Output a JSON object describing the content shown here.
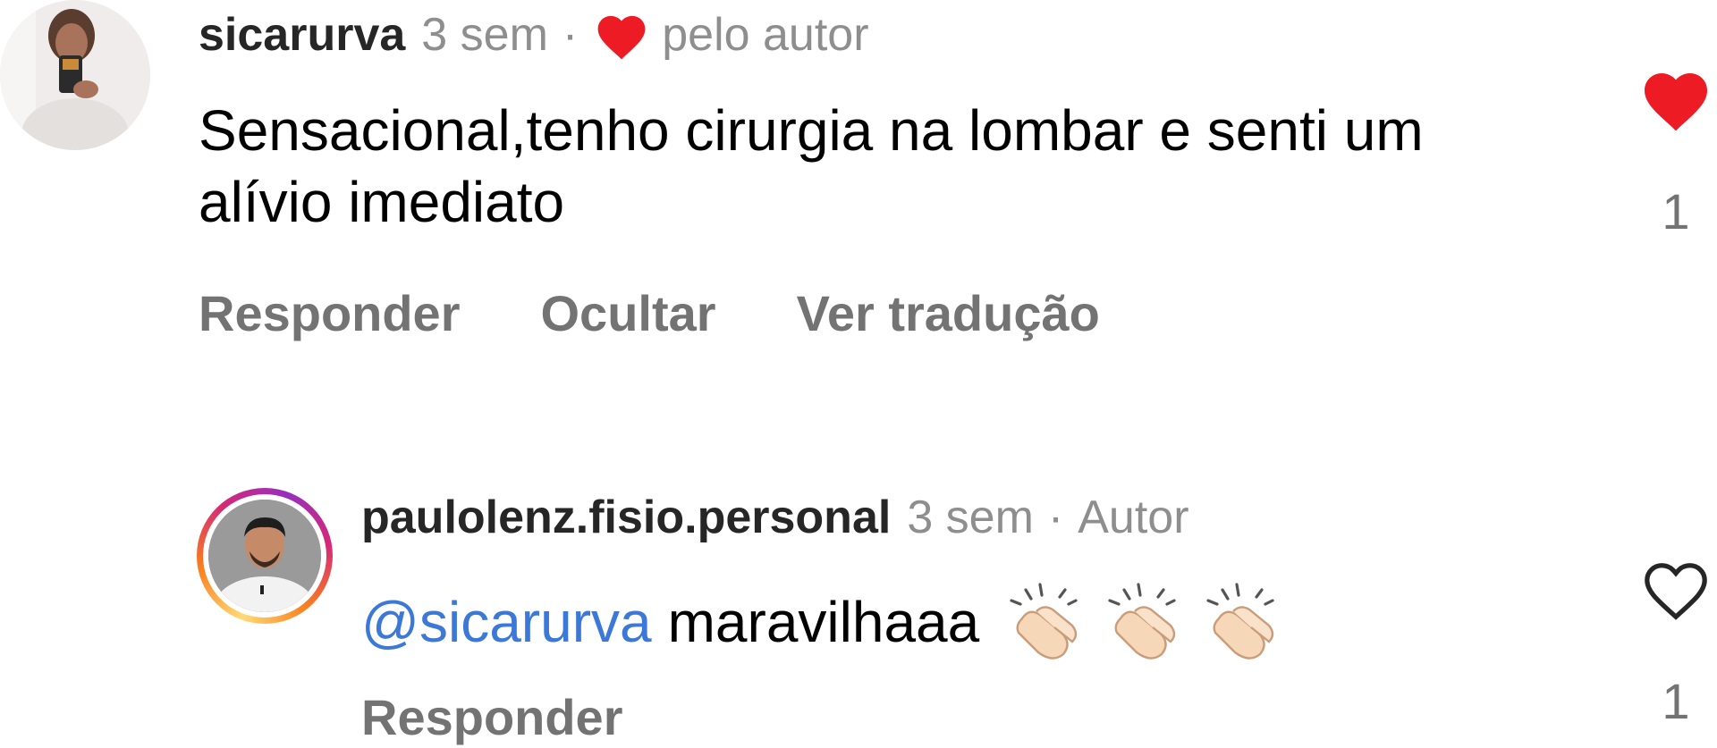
{
  "comments": [
    {
      "username": "sicarurva",
      "time": "3 sem",
      "separator": "·",
      "liked_by_author_label": "pelo autor",
      "text": "Sensacional,tenho cirurgia na lombar e senti um alívio imediato",
      "actions": [
        "Responder",
        "Ocultar",
        "Ver tradução"
      ],
      "likes": "1",
      "liked": true
    },
    {
      "username": "paulolenz.fisio.personal",
      "time": "3 sem",
      "separator": "·",
      "author_badge": "Autor",
      "mention": "@sicarurva",
      "text": "maravilhaaa",
      "emoji": [
        "clapping-hands-icon",
        "clapping-hands-icon",
        "clapping-hands-icon"
      ],
      "actions": [
        "Responder"
      ],
      "likes": "1",
      "liked": false
    }
  ],
  "colors": {
    "heart_red": "#ed1c24",
    "mention_blue": "#3b78d8",
    "muted_gray": "#8e8e8e",
    "action_gray": "#737373"
  }
}
